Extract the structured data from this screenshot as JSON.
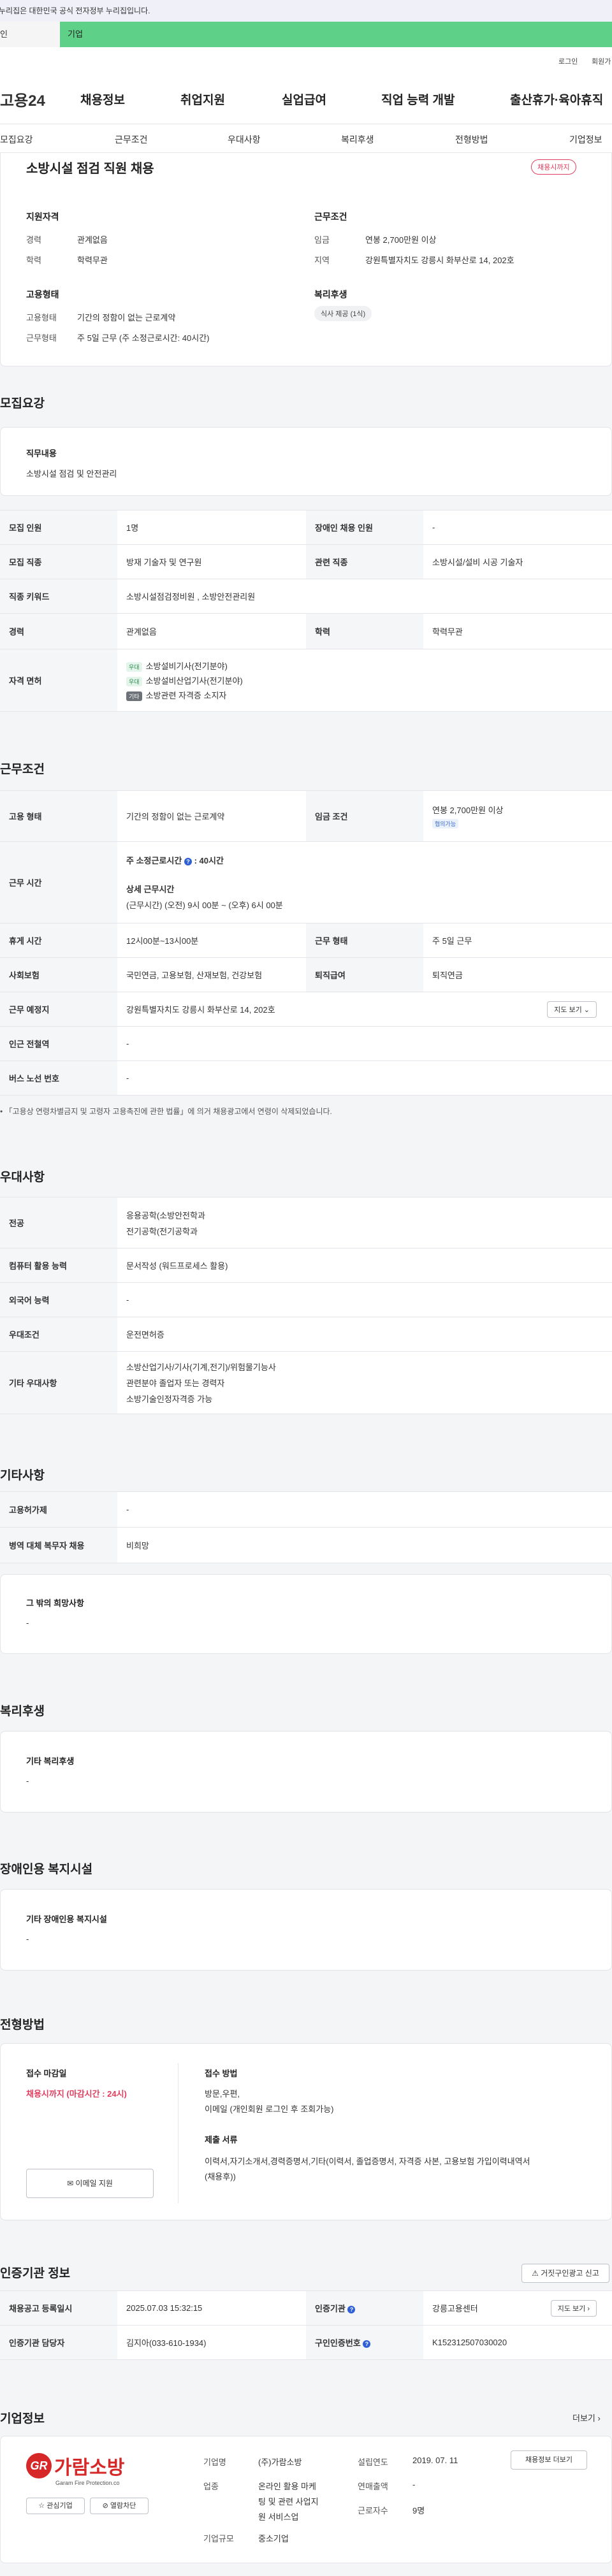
{
  "gov_notice": "이 누리집은 대한민국 공식 전자정부 누리집입니다.",
  "gov_notice_visible": "누리집은 대한민국 공식 전자정부 누리집입니다.",
  "tabs": {
    "personal": "개인",
    "personal_visible": "인",
    "company": "기업"
  },
  "util": {
    "login": "로그인",
    "signup": "회원가"
  },
  "logo": "고용24",
  "gnb": [
    "채용정보",
    "취업지원",
    "실업급여",
    "직업 능력 개발",
    "출산휴가·육아휴직"
  ],
  "snb": [
    "모집요강",
    "근무조건",
    "우대사항",
    "복리후생",
    "전형방법",
    "기업정보"
  ],
  "summary": {
    "title": "소방시설 점검 직원 채용",
    "deadline_badge": "채용시까지",
    "qualification": {
      "heading": "지원자격",
      "rows": [
        [
          "경력",
          "관계없음"
        ],
        [
          "학력",
          "학력무관"
        ]
      ]
    },
    "conditions": {
      "heading": "근무조건",
      "rows": [
        [
          "임금",
          "연봉 2,700만원 이상"
        ],
        [
          "지역",
          "강원특별자치도 강릉시 화부산로 14, 202호"
        ]
      ]
    },
    "employment": {
      "heading": "고용형태",
      "rows": [
        [
          "고용형태",
          "기간의 정함이 없는 근로계약"
        ],
        [
          "근무형태",
          "주 5일 근무 (주 소정근로시간: 40시간)"
        ]
      ]
    },
    "welfare": {
      "heading": "복리후생",
      "chip": "식사 제공 (1식)"
    }
  },
  "recruit": {
    "title": "모집요강",
    "duty_label": "직무내용",
    "duty_text": "소방시설 점검 및 안전관리",
    "rows": {
      "headcount_l": "모집 인원",
      "headcount_v": "1명",
      "disabled_l": "장애인 채용 인원",
      "disabled_v": "-",
      "job_l": "모집 직종",
      "job_v": "방재 기술자 및 연구원",
      "related_l": "관련 직종",
      "related_v": "소방시설/설비 시공 기술자",
      "keyword_l": "직종 키워드",
      "keyword_v": "소방시설점검정비원 , 소방안전관리원",
      "career_l": "경력",
      "career_v": "관계없음",
      "edu_l": "학력",
      "edu_v": "학력무관",
      "license_l": "자격 면허",
      "licenses": [
        {
          "tag": "우대",
          "name": "소방설비기사(전기분야)"
        },
        {
          "tag": "우대",
          "name": "소방설비산업기사(전기분야)"
        },
        {
          "tag": "기타",
          "name": "소방관련 자격증 소지자"
        }
      ]
    }
  },
  "work": {
    "title": "근무조건",
    "type_l": "고용 형태",
    "type_v": "기간의 정함이 없는 근로계약",
    "wage_l": "임금 조건",
    "wage_v": "연봉 2,700만원 이상",
    "wage_chip": "협의가능",
    "hours_l": "근무 시간",
    "hours_main": "주 소정근로시간",
    "hours_num": "40시간",
    "hours_detail_label": "상세 근무시간",
    "hours_detail": "(근무시간) (오전) 9시 00분 ~ (오후) 6시 00분",
    "break_l": "휴게 시간",
    "break_v": "12시00분~13시00분",
    "form_l": "근무 형태",
    "form_v": "주 5일 근무",
    "insurance_l": "사회보험",
    "insurance_v": "국민연금, 고용보험, 산재보험, 건강보험",
    "retire_l": "퇴직급여",
    "retire_v": "퇴직연금",
    "place_l": "근무 예정지",
    "place_v": "강원특별자치도 강릉시 화부산로 14, 202호",
    "map_btn": "지도 보기",
    "station_l": "인근 전철역",
    "station_v": "-",
    "bus_l": "버스 노선 번호",
    "bus_v": "-",
    "note": "「고용상 연령차별금지 및 고령자 고용촉진에 관한 법률」에 의거 채용광고에서 연령이 삭제되었습니다."
  },
  "prefer": {
    "title": "우대사항",
    "major_l": "전공",
    "major_v1": "응용공학(소방안전학과",
    "major_v2": "전기공학(전기공학과",
    "computer_l": "컴퓨터 활용 능력",
    "computer_v": "문서작성 (워드프로세스 활용)",
    "lang_l": "외국어 능력",
    "lang_v": "-",
    "cond_l": "우대조건",
    "cond_v": "운전면허증",
    "etc_l": "기타 우대사항",
    "etc_v1": "소방산업기사/기사(기계,전기)/위험물기능사",
    "etc_v2": "관련분야 졸업자 또는 경력자",
    "etc_v3": "소방기술인정자격증 가능"
  },
  "other": {
    "title": "기타사항",
    "permit_l": "고용허가제",
    "permit_v": "-",
    "military_l": "병역 대체 복무자 채용",
    "military_v": "비희망",
    "wish_label": "그 밖의 희망사항",
    "wish_v": "-"
  },
  "benefit": {
    "title": "복리후생",
    "label": "기타 복리후생",
    "value": "-"
  },
  "disabled_fac": {
    "title": "장애인용 복지시설",
    "label": "기타 장애인용 복지시설",
    "value": "-"
  },
  "screening": {
    "title": "전형방법",
    "close_label": "접수 마감일",
    "close_value": "채용시까지 (마감시간 : 24시)",
    "email_btn": "이메일 지원",
    "method_label": "접수 방법",
    "method_v1": "방문,우편,",
    "method_v2": "이메일 (개인회원 로그인 후 조회가능)",
    "docs_label": "제출 서류",
    "docs_v1": "이력서,자기소개서,경력증명서,기타(이력서, 졸업증명서, 자격증 사본, 고용보험 가입이력내역서",
    "docs_v2": "(채용후))"
  },
  "cert": {
    "title": "인증기관 정보",
    "report_btn": "거짓구인광고 신고",
    "reg_l": "채용공고 등록일시",
    "reg_v": "2025.07.03 15:32:15",
    "org_l": "인증기관",
    "org_v": "강릉고용센터",
    "map_btn": "지도 보기",
    "manager_l": "인증기관 담당자",
    "manager_v": "김지아(033-610-1934)",
    "no_l": "구인인증번호",
    "no_v": "K152312507030020"
  },
  "company": {
    "title": "기업정보",
    "more": "더보기",
    "logo_text": "가람소방",
    "logo_sub": "Garam Fire Protection.co",
    "fav_btn": "관심기업",
    "block_btn": "열람차단",
    "name_l": "기업명",
    "name_v": "(주)가람소방",
    "biz_l": "업종",
    "biz_v1": "온라인 활용 마케",
    "biz_v2": "팅 및 관련 사업지",
    "biz_v3": "원 서비스업",
    "size_l": "기업규모",
    "size_v": "중소기업",
    "founded_l": "설립연도",
    "founded_v": "2019. 07. 11",
    "sales_l": "연매출액",
    "sales_v": "-",
    "staff_l": "근로자수",
    "staff_v": "9명",
    "info_btn": "채용정보 더보기"
  },
  "colors": {
    "accent_green": "#5fd088",
    "deadline_red": "#e13e5f",
    "cert_blue": "#2f5fd6"
  }
}
